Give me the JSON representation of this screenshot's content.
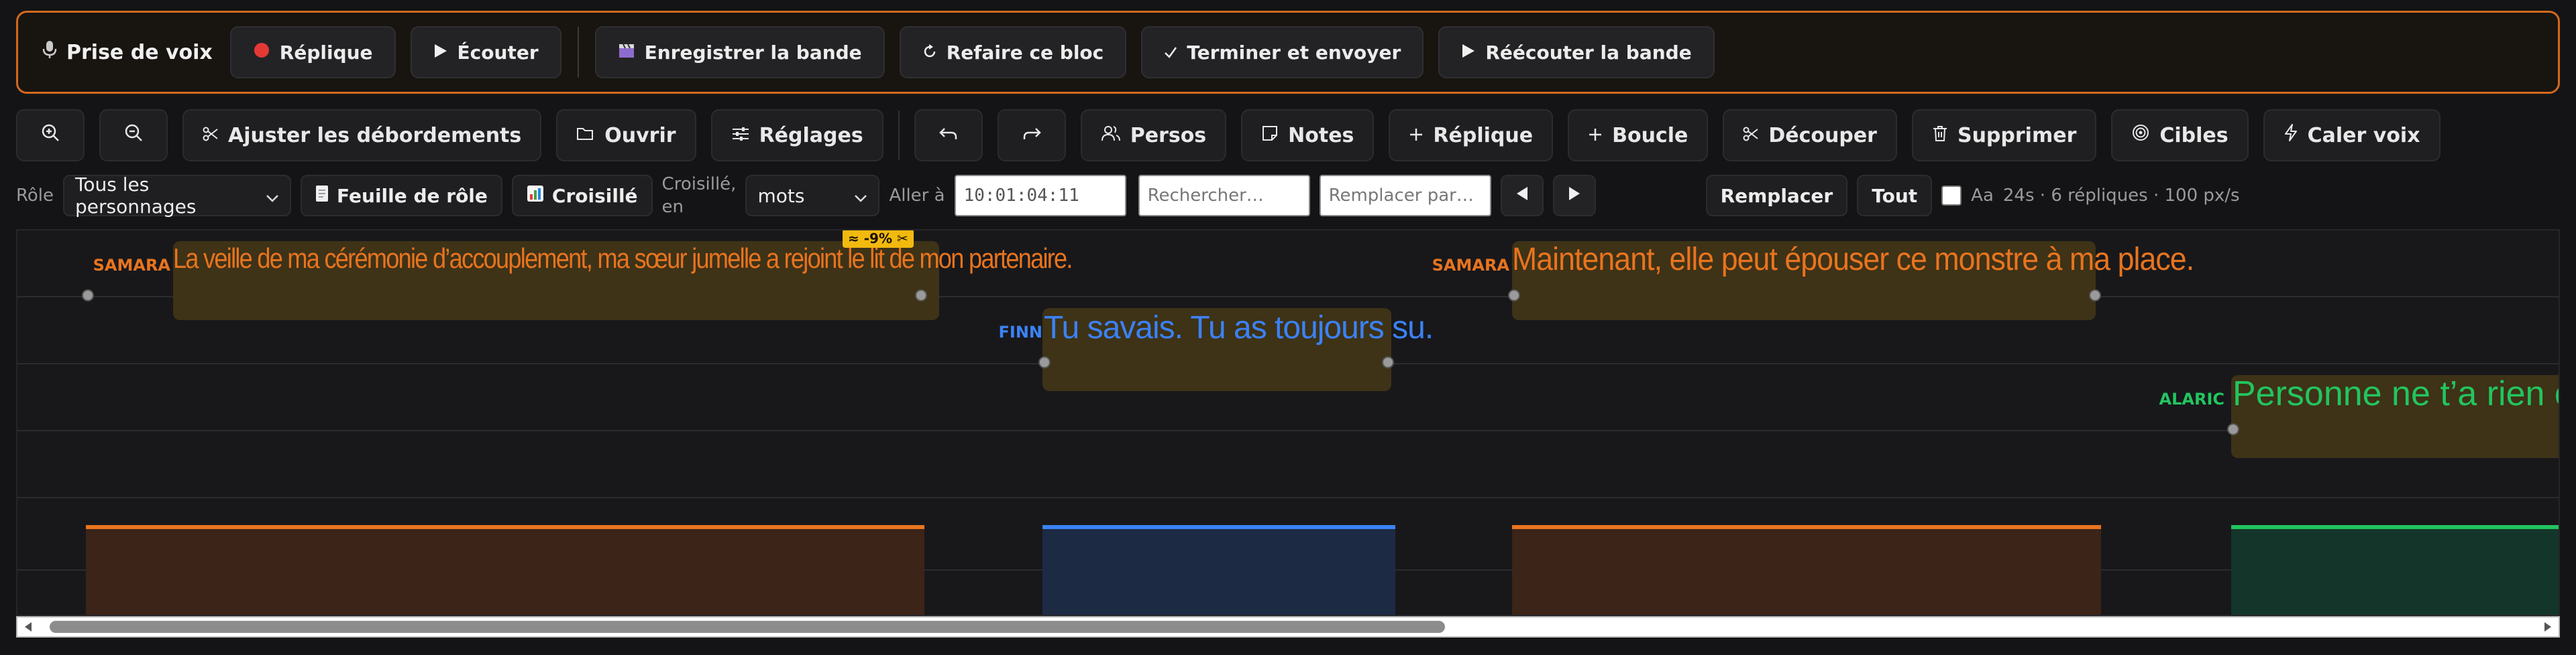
{
  "record_bar": {
    "title": "Prise de voix",
    "buttons": [
      {
        "label": "Réplique",
        "icon": "record-dot-icon"
      },
      {
        "label": "Écouter",
        "icon": "play-icon"
      },
      {
        "label": "Enregistrer la bande",
        "icon": "clapperboard-icon"
      },
      {
        "label": "Refaire ce bloc",
        "icon": "redo-circle-icon"
      },
      {
        "label": "Terminer et envoyer",
        "icon": "check-icon"
      },
      {
        "label": "Réécouter la bande",
        "icon": "play-icon"
      }
    ]
  },
  "toolbar": {
    "fit_overflow": "Ajuster les débordements",
    "open": "Ouvrir",
    "settings": "Réglages",
    "characters": "Persos",
    "notes": "Notes",
    "add_line": "Réplique",
    "loop": "Boucle",
    "cut": "Découper",
    "delete": "Supprimer",
    "targets": "Cibles",
    "sync_voice": "Caler voix"
  },
  "filters": {
    "role_label": "Rôle",
    "role_value": "Tous les personnages",
    "role_sheet": "Feuille de rôle",
    "crossfade": "Croisillé",
    "crossfade_in_label_1": "Croisillé,",
    "crossfade_in_label_2": "en",
    "unit_value": "mots",
    "goto_label": "Aller à",
    "goto_value": "10:01:04:11",
    "search_placeholder": "Rechercher…",
    "replace_placeholder": "Remplacer par…",
    "replace_button": "Remplacer",
    "all_button": "Tout",
    "case_label": "Aa",
    "status": "24s · 6 répliques · 100 px/s"
  },
  "timeline": {
    "cues": [
      {
        "character": "SAMARA",
        "text": "La veille de ma cérémonie d’accouplement, ma sœur jumelle a rejoint le lit de mon partenaire.",
        "color": "#e8741e",
        "badge": "≈ -9% ✂"
      },
      {
        "character": "FINN",
        "text": "Tu savais. Tu as toujours su.",
        "color": "#3b82f6"
      },
      {
        "character": "SAMARA",
        "text": "Maintenant, elle peut épouser ce monstre à ma place.",
        "color": "#e8741e"
      },
      {
        "character": "ALARIC",
        "text": "Personne ne t’a rien c",
        "color": "#22c55e"
      }
    ]
  },
  "colors": {
    "samara": "#e8741e",
    "finn": "#3b82f6",
    "alaric": "#22c55e",
    "record_border": "#d2691e"
  }
}
